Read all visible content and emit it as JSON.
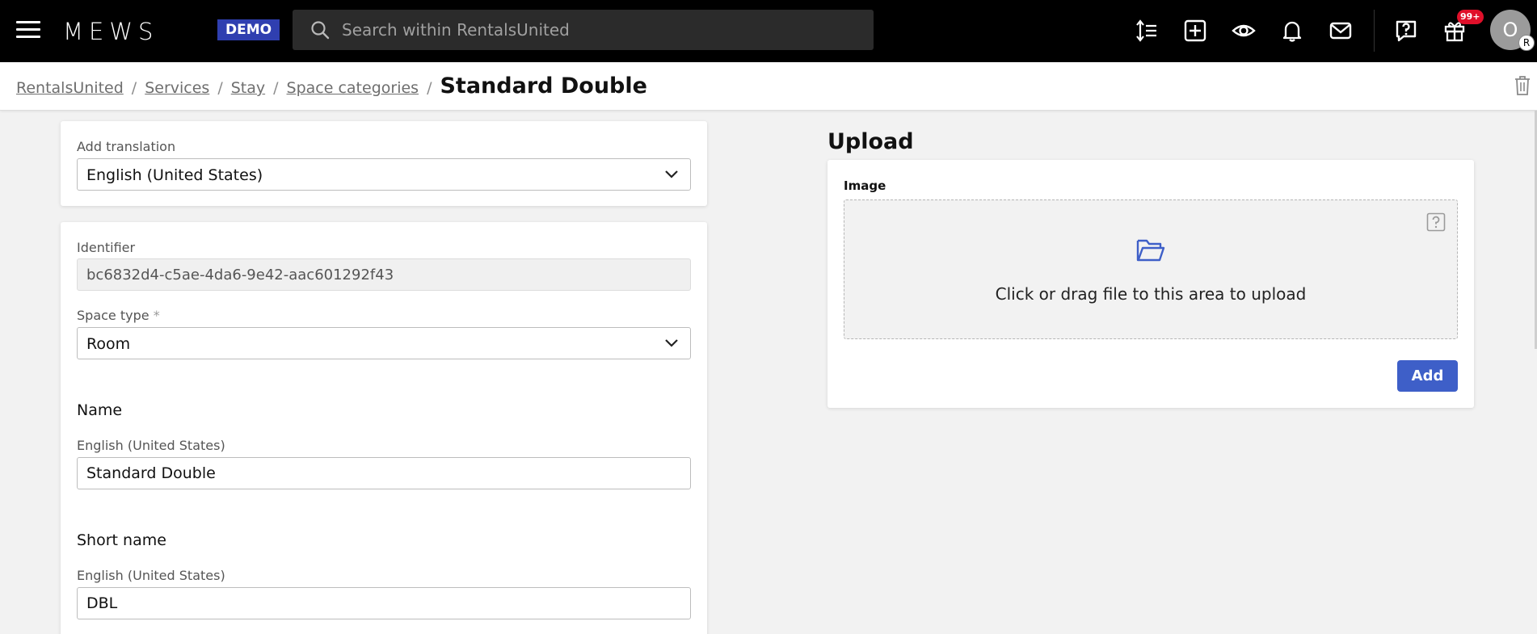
{
  "topbar": {
    "logo": "MEWS",
    "demo_badge": "DEMO",
    "search_placeholder": "Search within RentalsUnited",
    "notification_count": "99+",
    "avatar_initial": "O",
    "avatar_sub_initial": "R",
    "icons": [
      "sort-icon",
      "add-square-icon",
      "eye-icon",
      "bell-icon",
      "mail-icon",
      "help-chat-icon",
      "gift-icon"
    ]
  },
  "breadcrumb": {
    "items": [
      "RentalsUnited",
      "Services",
      "Stay",
      "Space categories"
    ],
    "current": "Standard Double"
  },
  "translation_card": {
    "label": "Add translation",
    "selected": "English (United States)"
  },
  "details_card": {
    "identifier_label": "Identifier",
    "identifier_value": "bc6832d4-c5ae-4da6-9e42-aac601292f43",
    "space_type_label": "Space type",
    "space_type_required": "*",
    "space_type_value": "Room",
    "name_title": "Name",
    "name_lang_label": "English (United States)",
    "name_value": "Standard Double",
    "short_name_title": "Short name",
    "short_name_lang_label": "English (United States)",
    "short_name_value": "DBL"
  },
  "upload": {
    "title": "Upload",
    "image_label": "Image",
    "dropzone_text": "Click or drag file to this area to upload",
    "add_button": "Add"
  },
  "colors": {
    "topbar": "#000000",
    "demo_badge": "#2f3fb0",
    "accent_button": "#3e5fc8",
    "notification": "#e0102a"
  }
}
